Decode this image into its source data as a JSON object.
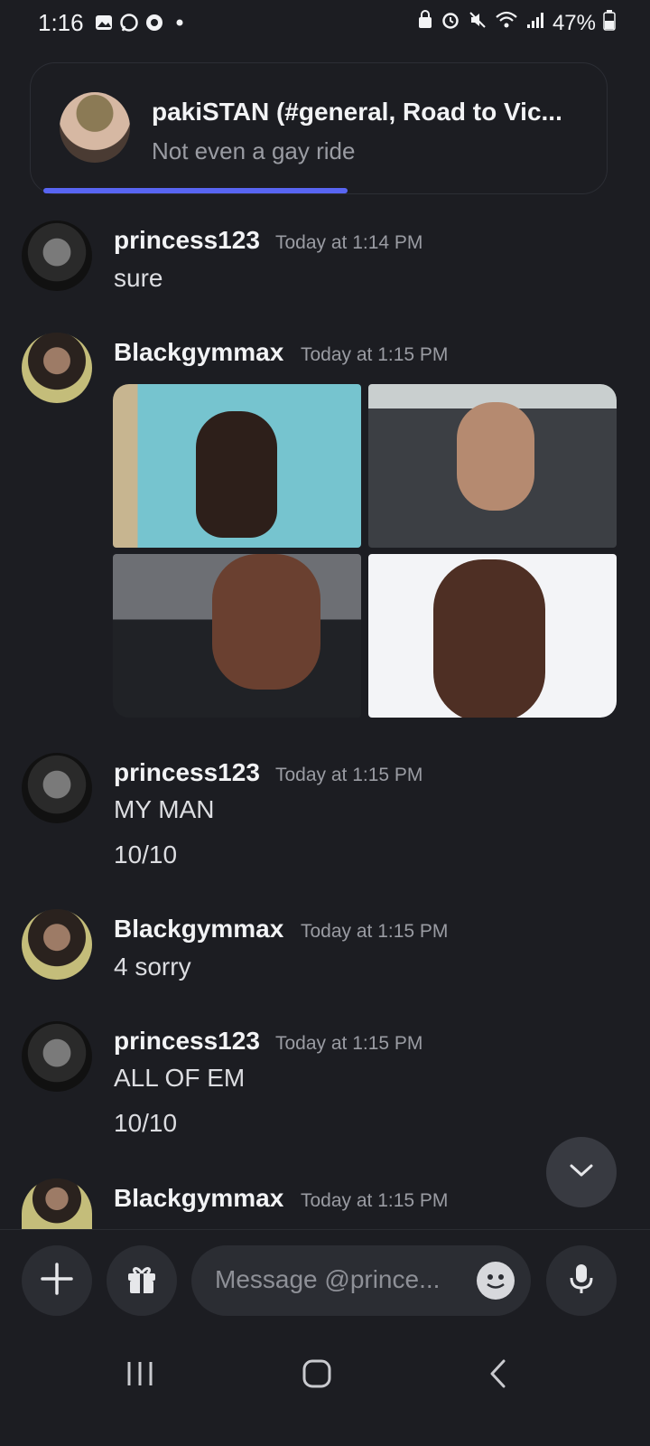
{
  "status_bar": {
    "time": "1:16",
    "battery": "47%",
    "left_icons": [
      "gallery-icon",
      "whatsapp-icon",
      "chrome-icon",
      "dot-icon"
    ],
    "right_icons": [
      "lock-icon",
      "alarm-icon",
      "mute-icon",
      "wifi-icon",
      "signal-icon",
      "battery-icon"
    ]
  },
  "notification": {
    "title": "pakiSTAN (#general, Road to Vic...",
    "subtitle": "Not even a gay ride",
    "progress": 0.55
  },
  "messages": [
    {
      "user": "princess123",
      "time": "Today at 1:14 PM",
      "lines": [
        "sure"
      ]
    },
    {
      "user": "Blackgymmax",
      "time": "Today at 1:15 PM",
      "images": 4
    },
    {
      "user": "princess123",
      "time": "Today at 1:15 PM",
      "lines": [
        "MY MAN",
        "10/10"
      ]
    },
    {
      "user": "Blackgymmax",
      "time": "Today at 1:15 PM",
      "lines": [
        "4 sorry"
      ]
    },
    {
      "user": "princess123",
      "time": "Today at 1:15 PM",
      "lines": [
        "ALL OF EM",
        "10/10"
      ]
    },
    {
      "user": "Blackgymmax",
      "time": "Today at 1:15 PM",
      "lines": []
    }
  ],
  "composer": {
    "placeholder": "Message @prince..."
  },
  "colors": {
    "background": "#1c1d22",
    "accent": "#5865f2",
    "muted_text": "#9a9ca3"
  }
}
